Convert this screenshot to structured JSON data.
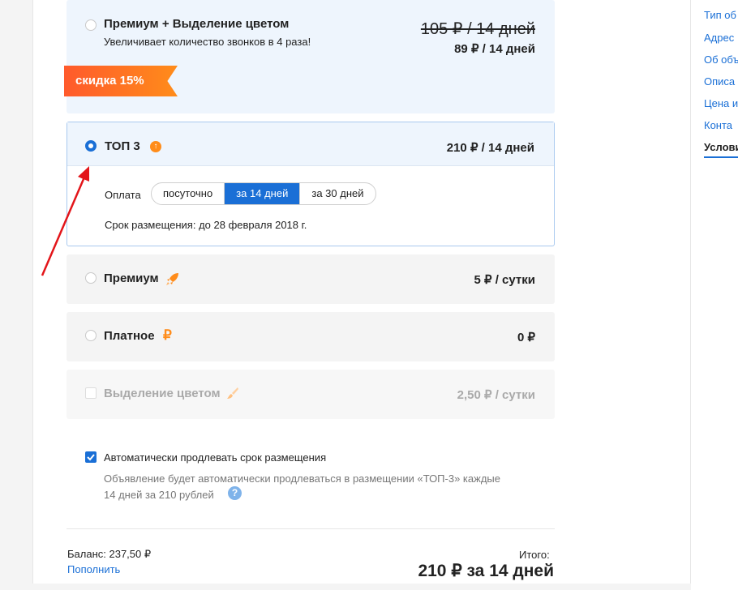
{
  "rightnav": {
    "items": [
      "Тип об",
      "Адрес",
      "Об объ",
      "Описа",
      "Цена и",
      "Конта",
      "Услови"
    ]
  },
  "options": {
    "premium_color": {
      "title": "Премиум + Выделение цветом",
      "subtitle": "Увеличивает количество звонков в 4 раза!",
      "old_price": "105 ₽ / 14 дней",
      "price": "89 ₽ / 14 дней",
      "discount": "скидка 15%"
    },
    "top3": {
      "title": "ТОП 3",
      "price": "210 ₽ / 14 дней",
      "payment_label": "Оплата",
      "payment_options": [
        "посуточно",
        "за 14 дней",
        "за 30 дней"
      ],
      "payment_selected": "за 14 дней",
      "term": "Срок размещения: до 28 февраля 2018 г."
    },
    "premium": {
      "title": "Премиум",
      "price": "5 ₽ / сутки"
    },
    "paid": {
      "title": "Платное",
      "price": "0 ₽"
    },
    "color": {
      "title": "Выделение цветом",
      "price": "2,50 ₽ / сутки"
    }
  },
  "autorenew": {
    "label": "Автоматически продлевать срок размещения",
    "desc_line1": "Объявление будет автоматически продлеваться в размещении «ТОП-3» каждые",
    "desc_line2": "14 дней за 210 рублей",
    "checked": true
  },
  "footer": {
    "balance": "Баланс: 237,50 ₽",
    "topup": "Пополнить",
    "total_label": "Итого:",
    "total_value": "210 ₽ за 14 дней"
  },
  "colors": {
    "accent": "#1a6fd6",
    "orange": "#ff7a1a",
    "selected_bg": "#eef5fd",
    "card_bg": "#f4f4f4",
    "highlight_bg": "#eef5fd"
  }
}
